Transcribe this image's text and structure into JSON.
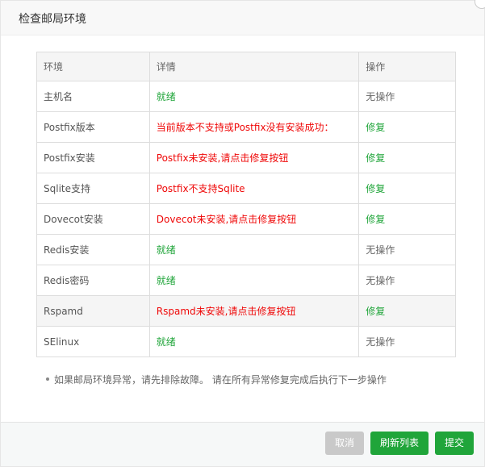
{
  "dialog": {
    "title": "检查邮局环境"
  },
  "table": {
    "headers": [
      "环境",
      "详情",
      "操作"
    ],
    "rows": [
      {
        "env": "主机名",
        "detail": "就绪",
        "detail_status": "ok",
        "action": "无操作",
        "action_type": "none"
      },
      {
        "env": "Postfix版本",
        "detail": "当前版本不支持或Postfix没有安装成功：",
        "detail_status": "err",
        "action": "修复",
        "action_type": "repair"
      },
      {
        "env": "Postfix安装",
        "detail": "Postfix未安装,请点击修复按钮",
        "detail_status": "err",
        "action": "修复",
        "action_type": "repair"
      },
      {
        "env": "Sqlite支持",
        "detail": "Postfix不支持Sqlite",
        "detail_status": "err",
        "action": "修复",
        "action_type": "repair"
      },
      {
        "env": "Dovecot安装",
        "detail": "Dovecot未安装,请点击修复按钮",
        "detail_status": "err",
        "action": "修复",
        "action_type": "repair"
      },
      {
        "env": "Redis安装",
        "detail": "就绪",
        "detail_status": "ok",
        "action": "无操作",
        "action_type": "none"
      },
      {
        "env": "Redis密码",
        "detail": "就绪",
        "detail_status": "ok",
        "action": "无操作",
        "action_type": "none"
      },
      {
        "env": "Rspamd",
        "detail": "Rspamd未安装,请点击修复按钮",
        "detail_status": "err",
        "action": "修复",
        "action_type": "repair"
      },
      {
        "env": "SElinux",
        "detail": "就绪",
        "detail_status": "ok",
        "action": "无操作",
        "action_type": "none"
      }
    ]
  },
  "note": "如果邮局环境异常，请先排除故障。 请在所有异常修复完成后执行下一步操作",
  "footer": {
    "cancel_label": "取消",
    "refresh_label": "刷新列表",
    "submit_label": "提交"
  },
  "colors": {
    "ok": "#20a53a",
    "error": "#ef0808",
    "primary": "#20a53a",
    "disabled": "#c9c9c9"
  }
}
